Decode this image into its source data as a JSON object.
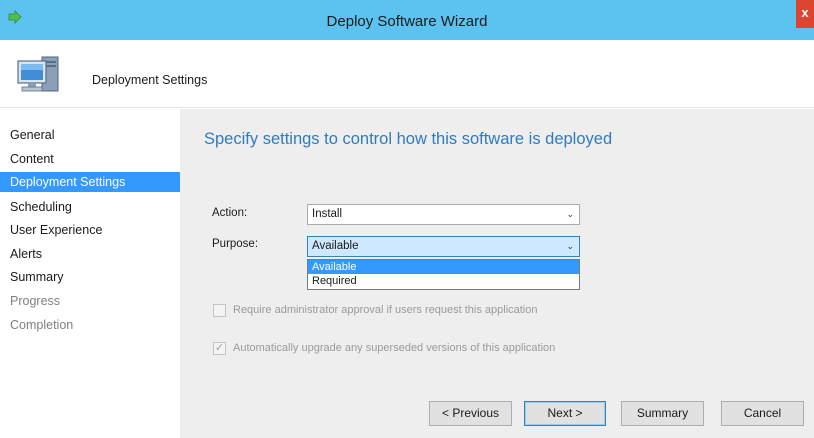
{
  "window": {
    "title": "Deploy Software Wizard",
    "close_glyph": "x"
  },
  "header": {
    "title": "Deployment Settings",
    "icon": "computer-icon"
  },
  "sidebar": {
    "items": [
      {
        "label": "General",
        "state": "normal"
      },
      {
        "label": "Content",
        "state": "normal"
      },
      {
        "label": "Deployment Settings",
        "state": "active"
      },
      {
        "label": "Scheduling",
        "state": "normal"
      },
      {
        "label": "User Experience",
        "state": "normal"
      },
      {
        "label": "Alerts",
        "state": "normal"
      },
      {
        "label": "Summary",
        "state": "normal"
      },
      {
        "label": "Progress",
        "state": "disabled"
      },
      {
        "label": "Completion",
        "state": "disabled"
      }
    ]
  },
  "main": {
    "heading": "Specify settings to control how this software is deployed",
    "action": {
      "label": "Action:",
      "value": "Install"
    },
    "purpose": {
      "label": "Purpose:",
      "value": "Available",
      "options": [
        "Available",
        "Required"
      ],
      "highlighted": "Available"
    },
    "checkbox_admin": {
      "label": "Require administrator approval if users request this application",
      "checked": false,
      "enabled": false
    },
    "checkbox_upgrade": {
      "label": "Automatically upgrade any superseded versions of this application",
      "checked": true,
      "enabled": false
    }
  },
  "buttons": {
    "previous": "< Previous",
    "next": "Next >",
    "summary": "Summary",
    "cancel": "Cancel"
  },
  "colors": {
    "titlebar": "#5cc2f0",
    "accent": "#3399ff",
    "heading": "#2e7bc4",
    "panel": "#eeeeee"
  }
}
